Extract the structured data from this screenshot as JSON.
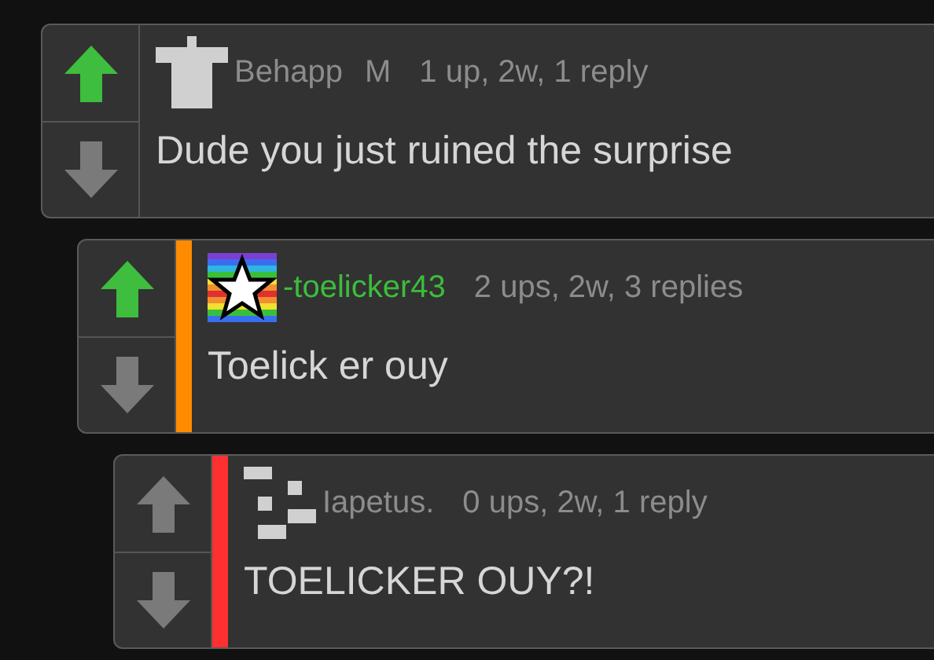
{
  "comments": [
    {
      "avatar": {
        "kind": "shirt"
      },
      "username": "Behapp",
      "name_highlighted": false,
      "badge": "M",
      "meta": "1 up, 2w, 1 reply",
      "text": "Dude you just ruined the surprise",
      "upvoted": true,
      "children": [
        {
          "avatar": {
            "kind": "pride-star"
          },
          "username": "-toelicker43",
          "name_highlighted": true,
          "meta": "2 ups, 2w, 3 replies",
          "text": "Toelick er ouy",
          "upvoted": true,
          "color": "#ff8c00",
          "children": [
            {
              "avatar": {
                "kind": "pixel"
              },
              "username": "Iapetus.",
              "name_highlighted": false,
              "meta": "0 ups, 2w, 1 reply",
              "text": "TOELICKER OUY?!",
              "upvoted": false,
              "color": "#ff3030"
            }
          ]
        }
      ]
    }
  ]
}
